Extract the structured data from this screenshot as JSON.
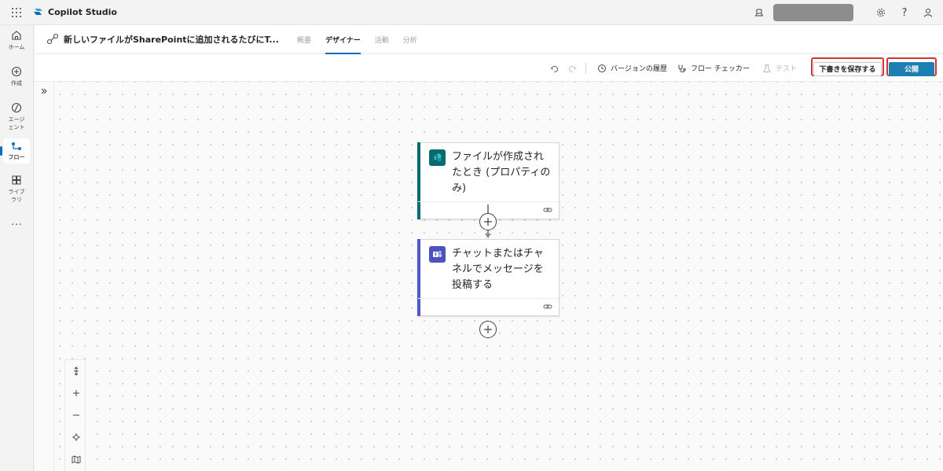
{
  "app": {
    "name": "Copilot Studio",
    "brand_color": "#0f6cbd"
  },
  "rail": {
    "items": [
      {
        "label": "ホーム",
        "icon": "home-icon"
      },
      {
        "label": "作成",
        "icon": "create-icon"
      },
      {
        "label": "エージェント",
        "icon": "agent-icon"
      },
      {
        "label": "フロー",
        "icon": "flow-icon",
        "active": true
      },
      {
        "label": "ライブラリ",
        "icon": "library-icon"
      }
    ],
    "more": "..."
  },
  "header": {
    "title": "新しいファイルがSharePointに追加されるたびにT...",
    "tabs": [
      {
        "label": "概要",
        "active": false
      },
      {
        "label": "デザイナー",
        "active": true
      },
      {
        "label": "活動",
        "active": false
      },
      {
        "label": "分析",
        "active": false
      }
    ]
  },
  "toolbar": {
    "version_history": "バージョンの履歴",
    "flow_checker": "フロー チェッカー",
    "test": "テスト",
    "save_draft": "下書きを保存する",
    "publish": "公開"
  },
  "canvas": {
    "cards": [
      {
        "title": "ファイルが作成されたとき (プロパティのみ)",
        "connector": "SharePoint",
        "accent": "#036c70"
      },
      {
        "title": "チャットまたはチャネルでメッセージを投稿する",
        "connector": "Teams",
        "accent": "#5059c9"
      }
    ]
  }
}
